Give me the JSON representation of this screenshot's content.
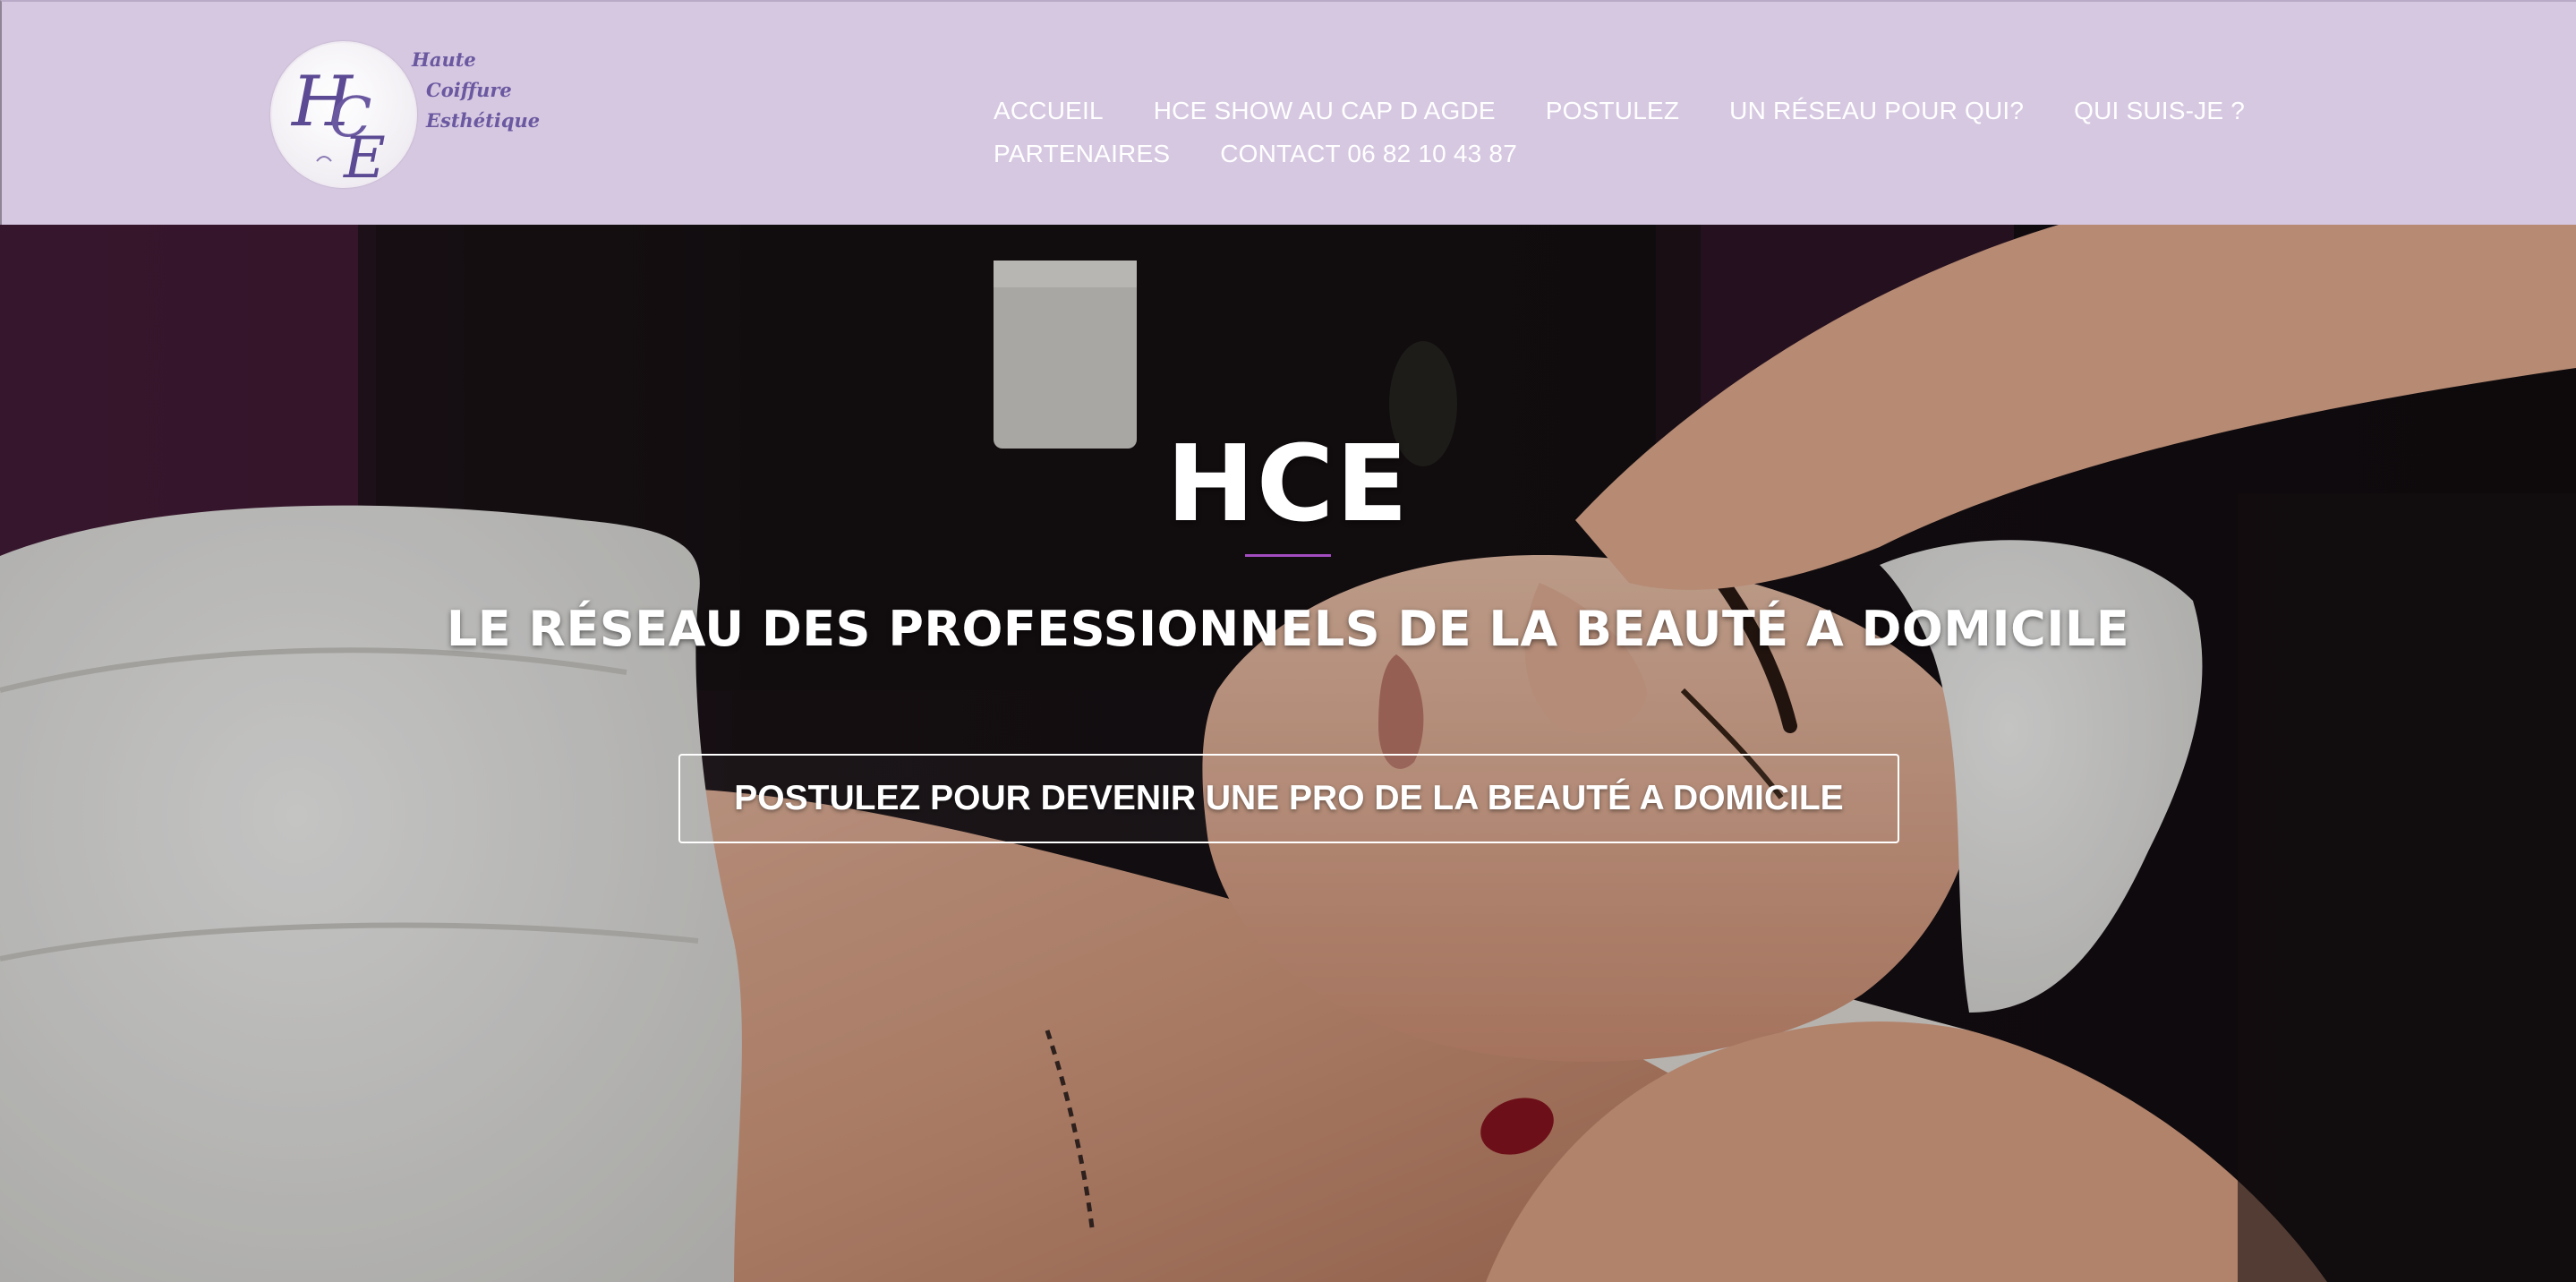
{
  "header": {
    "logo": {
      "monogram": "HCE",
      "lines": [
        "Haute",
        "Coiffure",
        "Esthétique"
      ]
    },
    "nav": {
      "row1": [
        "ACCUEIL",
        "HCE SHOW AU CAP D AGDE",
        "POSTULEZ",
        "UN RÉSEAU POUR QUI?",
        "QUI SUIS-JE ?"
      ],
      "row2": [
        "PARTENAIRES",
        "CONTACT 06 82 10 43 87"
      ]
    }
  },
  "hero": {
    "title": "HCE",
    "subtitle": "LE RÉSEAU DES PROFESSIONNELS DE LA BEAUTÉ A DOMICILE",
    "cta": "POSTULEZ POUR DEVENIR UNE PRO DE LA BEAUTÉ A DOMICILE"
  },
  "colors": {
    "header_bg": "#d6c8e1",
    "accent": "#a24cc0",
    "logo_text": "#6a58a0"
  }
}
